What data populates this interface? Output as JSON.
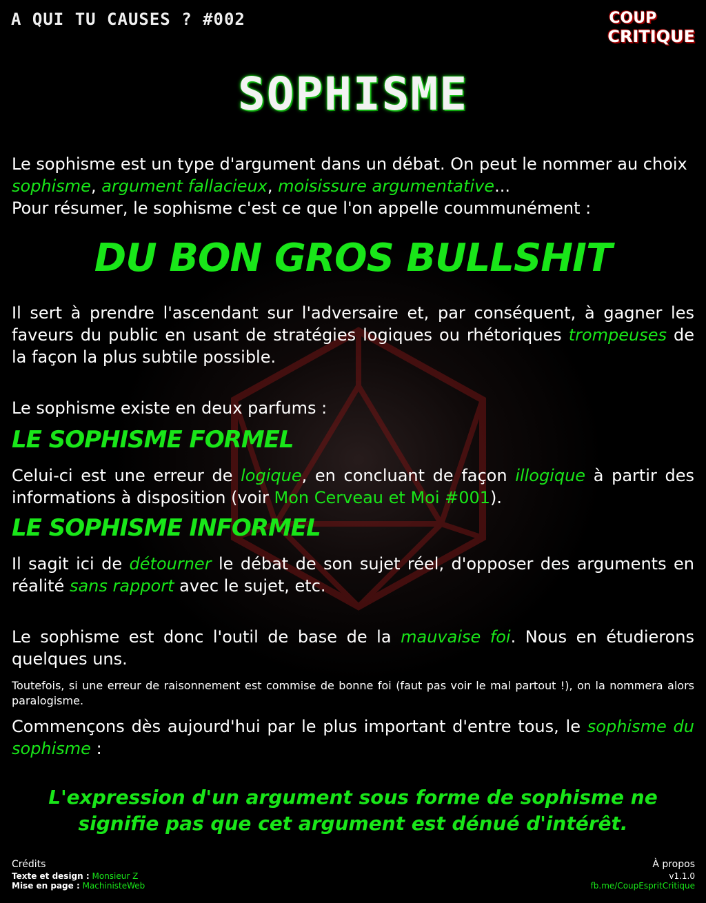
{
  "header": {
    "series": "A QUI TU CAUSES ? #002",
    "logo_line1": "COUP",
    "logo_line2": "CRITIQUE",
    "title": "SOPHISME"
  },
  "intro": {
    "t1": "Le sophisme est un type d'argument dans un débat. On peut le nommer au choix ",
    "k1": "sophisme",
    "t2": ", ",
    "k2": "argument fallacieux",
    "t3": ", ",
    "k3": "moisissure argumentative",
    "t4": "...",
    "t5": "Pour résumer, le sophisme c'est ce que l'on appelle coummunément :"
  },
  "bullshit": "DU BON GROS BULLSHIT",
  "purpose": {
    "t1": "Il sert à prendre l'ascendant sur l'adversaire et, par conséquent, à gagner les faveurs du public en usant de stratégies logiques ou rhétoriques ",
    "k1": "trompeuses",
    "t2": " de la façon la plus subtile possible."
  },
  "flavors_intro": "Le sophisme existe en deux parfums :",
  "formal": {
    "heading": "LE SOPHISME FORMEL",
    "t1": "Celui-ci est une erreur de ",
    "k1": "logique",
    "t2": ", en concluant de façon ",
    "k2": "illogique",
    "t3": " à partir des informations à disposition (voir ",
    "link": "Mon Cerveau et Moi #001",
    "t4": ")."
  },
  "informal": {
    "heading": "LE SOPHISME INFORMEL",
    "t1": "Il sagit ici de ",
    "k1": "détourner",
    "t2": " le débat de son sujet réel, d'opposer des arguments en réalité ",
    "k2": "sans rapport",
    "t3": " avec le sujet, etc."
  },
  "bad_faith": {
    "t1": "Le sophisme est donc l'outil de base de la ",
    "k1": "mauvaise foi",
    "t2": ". Nous en étudierons quelques uns."
  },
  "note": "Toutefois, si une erreur de raisonnement est commise de bonne foi (faut pas voir le mal partout !), on la nommera alors paralogisme.",
  "start": {
    "t1": "Commençons dès aujourd'hui par le plus important d'entre tous, le ",
    "k1": "sophisme du sophisme",
    "t2": " :"
  },
  "quote": {
    "line1": "L'expression d'un argument sous forme de sophisme ne",
    "line2": "signifie pas que cet argument est dénué d'intérêt."
  },
  "credits": {
    "heading": "Crédits",
    "text_label": "Texte et design :",
    "text_value": "Monsieur Z",
    "layout_label": "Mise en page :",
    "layout_value": "MachinisteWeb"
  },
  "about": {
    "heading": "À propos",
    "version": "v1.1.0",
    "link": "fb.me/CoupEspritCritique"
  }
}
